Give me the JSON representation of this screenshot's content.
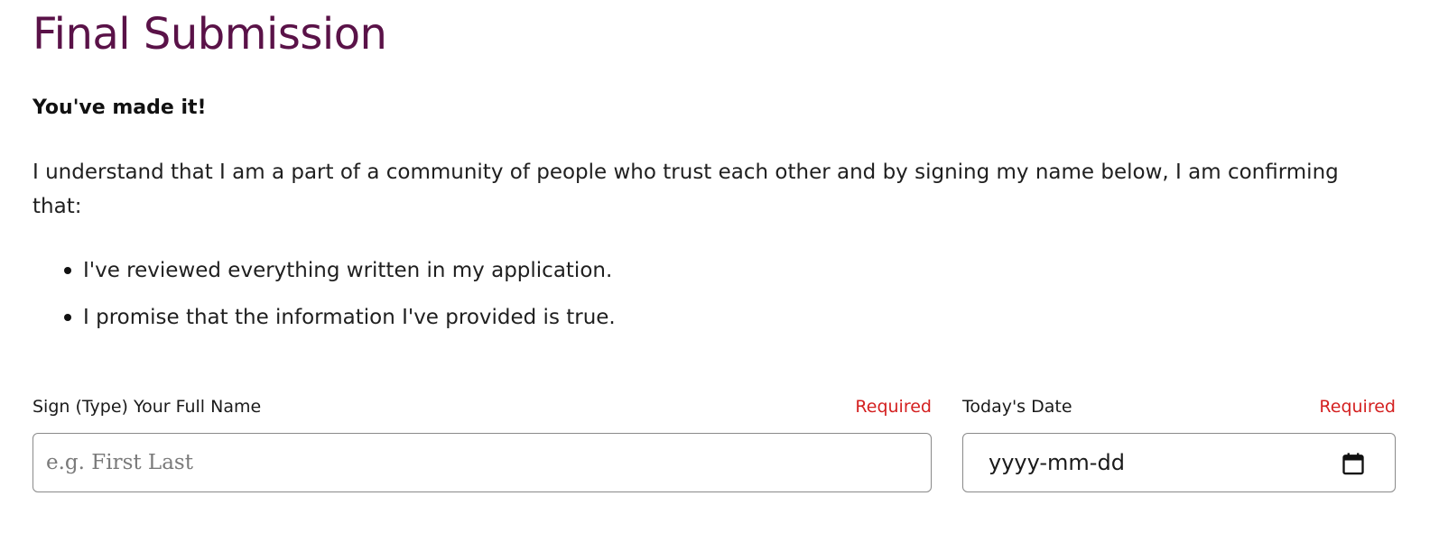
{
  "page": {
    "title": "Final Submission",
    "subtitle": "You've made it!",
    "intro": "I understand that I am a part of a community of people who trust each other and by signing my name below, I am confirming that:",
    "bullets": [
      "I've reviewed everything written in my application.",
      "I promise that the information I've provided is true."
    ]
  },
  "form": {
    "name_field": {
      "label": "Sign (Type) Your Full Name",
      "required_text": "Required",
      "placeholder": "e.g. First Last",
      "value": ""
    },
    "date_field": {
      "label": "Today's Date",
      "required_text": "Required",
      "value_display": "yyyy-mm-dd",
      "icon": "calendar-icon"
    }
  },
  "colors": {
    "title": "#5a1248",
    "required": "#d42020",
    "input_border": "#8a8a8a"
  }
}
